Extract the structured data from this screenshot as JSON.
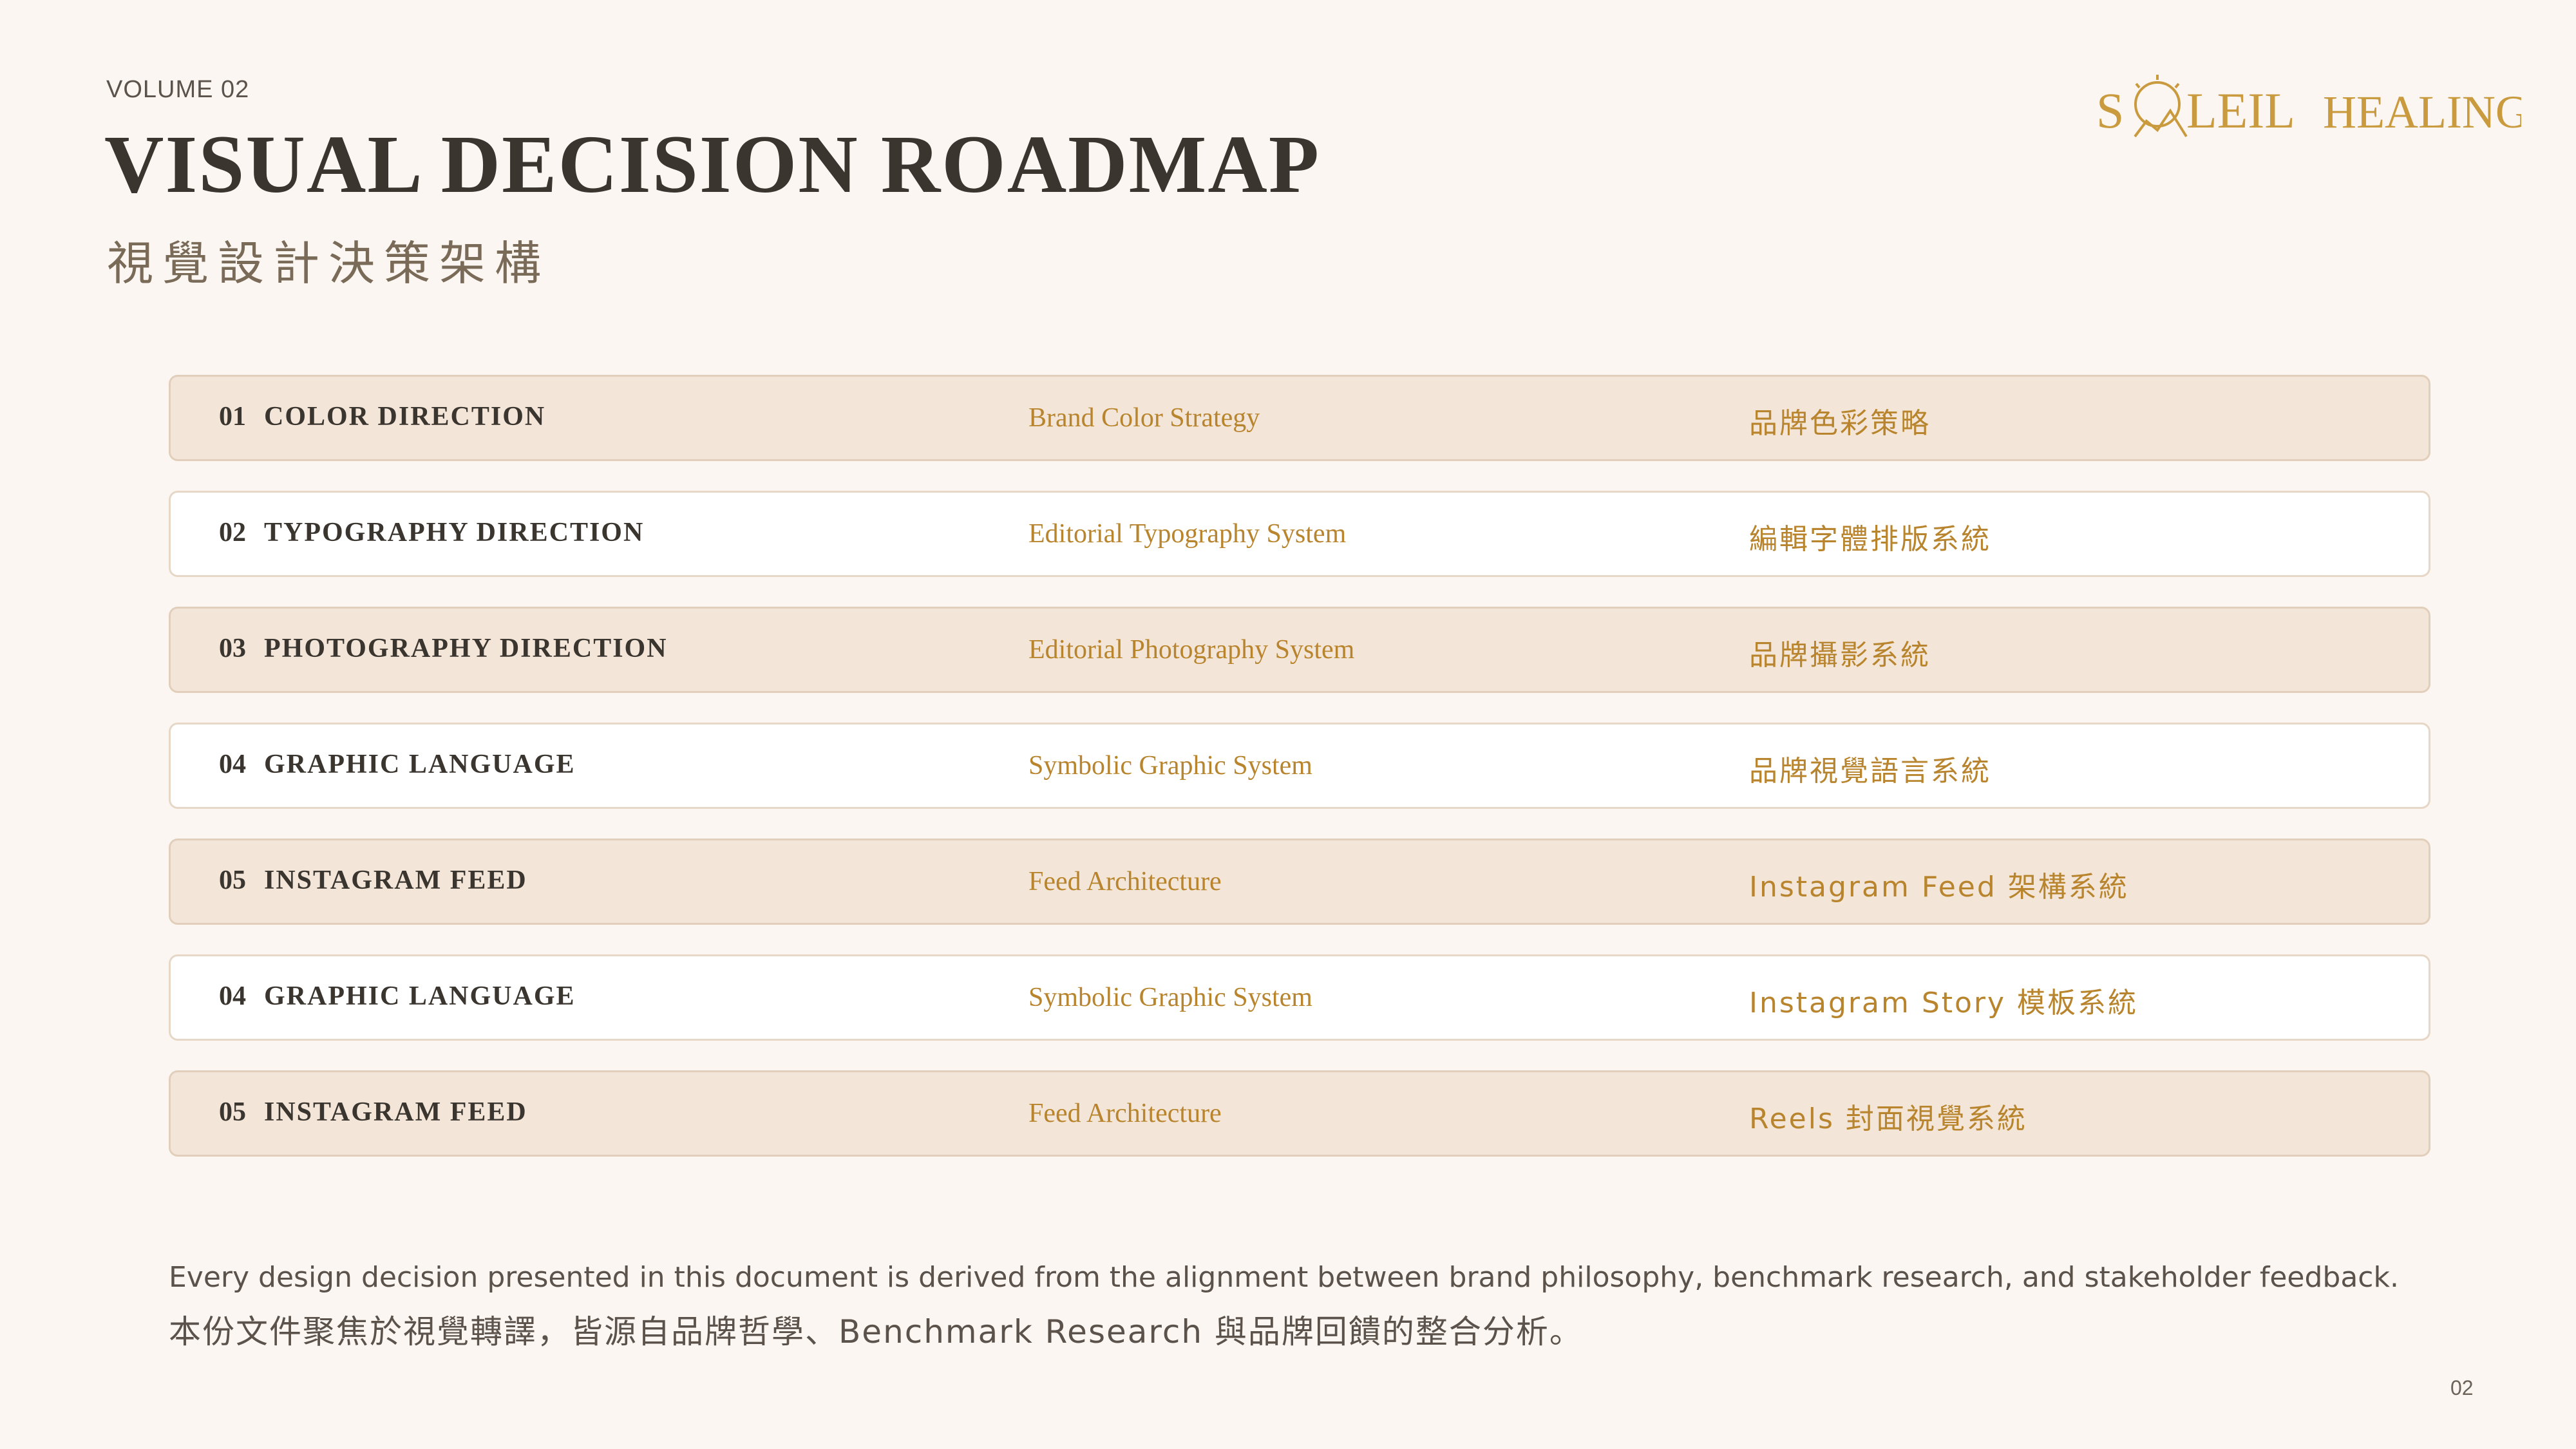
{
  "header": {
    "volume": "VOLUME 02",
    "title": "VISUAL DECISION ROADMAP",
    "subtitle": "視覺設計決策架構"
  },
  "logo": {
    "text_left": "S",
    "text_mid": "LEIL",
    "text_right": "HEALING",
    "icon": "sun-mountain-icon",
    "color": "#C99A3E"
  },
  "roadmap": {
    "rows": [
      {
        "num": "01",
        "name": "COLOR DIRECTION",
        "en": "Brand Color Strategy",
        "zh": "品牌色彩策略"
      },
      {
        "num": "02",
        "name": "TYPOGRAPHY DIRECTION",
        "en": "Editorial Typography System",
        "zh": "編輯字體排版系統"
      },
      {
        "num": "03",
        "name": "PHOTOGRAPHY DIRECTION",
        "en": "Editorial Photography System",
        "zh": "品牌攝影系統"
      },
      {
        "num": "04",
        "name": "GRAPHIC LANGUAGE",
        "en": "Symbolic Graphic System",
        "zh": "品牌視覺語言系統"
      },
      {
        "num": "05",
        "name": "INSTAGRAM FEED",
        "en": "Feed Architecture",
        "zh": "Instagram Feed 架構系統"
      },
      {
        "num": "04",
        "name": "GRAPHIC LANGUAGE",
        "en": "Symbolic Graphic System",
        "zh": "Instagram Story 模板系統"
      },
      {
        "num": "05",
        "name": "INSTAGRAM FEED",
        "en": "Feed Architecture",
        "zh": "Reels 封面視覺系統"
      }
    ]
  },
  "footer": {
    "en": "Every design decision presented in this document is derived from the alignment between brand philosophy, benchmark research, and stakeholder feedback.",
    "zh": "本份文件聚焦於視覺轉譯，皆源自品牌哲學、Benchmark Research 與品牌回饋的整合分析。"
  },
  "page_number": "02",
  "colors": {
    "background": "#FBF6F1",
    "accent": "#B8842D",
    "row_alt": "#F3E6D8",
    "text_dark": "#3A352F"
  }
}
